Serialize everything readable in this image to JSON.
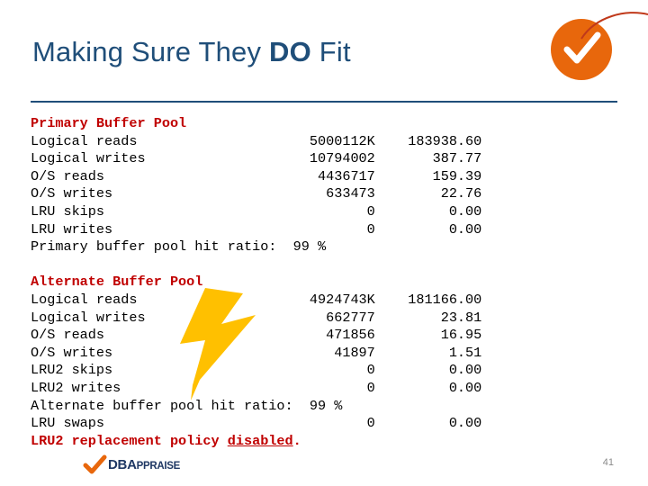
{
  "slide": {
    "title_part1": "Making Sure They ",
    "title_bold": "DO",
    "title_part2": " Fit",
    "page_number": "41",
    "logo": {
      "mark_name": "orange-check-circle",
      "accent_color": "#E8670C",
      "footer_brand_main": "DBA",
      "footer_brand_suffix": "PPRAISE"
    },
    "code": {
      "primary_header": "Primary Buffer Pool",
      "primary_rows": [
        "Logical reads                     5000112K    183938.60",
        "Logical writes                    10794002       387.77",
        "O/S reads                          4436717       159.39",
        "O/S writes                          633473        22.76",
        "LRU skips                                0         0.00",
        "LRU writes                               0         0.00",
        "Primary buffer pool hit ratio:  99 %"
      ],
      "alternate_header": "Alternate Buffer Pool",
      "alternate_rows": [
        "Logical reads                     4924743K    181166.00",
        "Logical writes                      662777        23.81",
        "O/S reads                           471856        16.95",
        "O/S writes                           41897         1.51",
        "LRU2 skips                               0         0.00",
        "LRU2 writes                              0         0.00",
        "Alternate buffer pool hit ratio:  99 %",
        "LRU swaps                                0         0.00"
      ],
      "footer_red_prefix": "LRU2 replacement policy ",
      "footer_red_underlined": "disabled",
      "footer_red_suffix": "."
    },
    "annotation": {
      "shape": "lightning-bolt",
      "fill_color": "#FFC000"
    }
  }
}
